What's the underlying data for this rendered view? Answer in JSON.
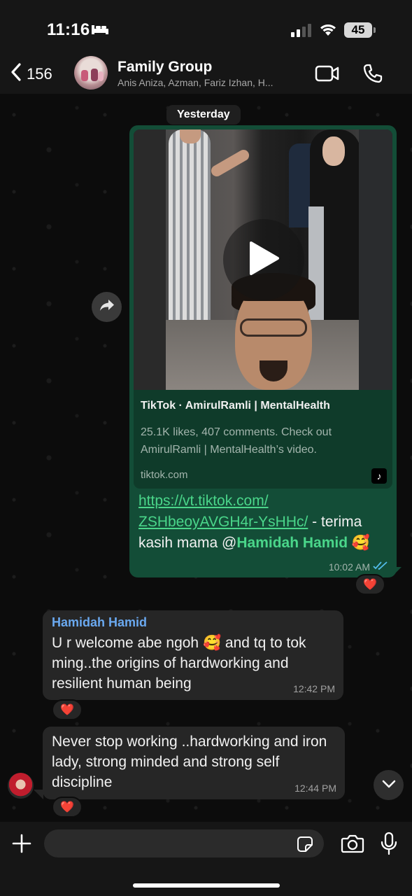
{
  "status_bar": {
    "time": "11:16",
    "battery": "45"
  },
  "header": {
    "back_count": "156",
    "group_name": "Family Group",
    "members": "Anis Aniza, Azman, Fariz Izhan, H..."
  },
  "chat": {
    "date_label": "Yesterday",
    "outgoing": {
      "card_title": "TikTok · AmirulRamli | MentalHealth",
      "card_description": "25.1K likes, 407 comments. Check out AmirulRamli | MentalHealth’s video.",
      "card_domain": "tiktok.com",
      "link_line1": "https://vt.tiktok.com/",
      "link_line2": "ZSHbeoyAVGH4r-YsHHc/",
      "text_after_link": " - terima kasih mama @",
      "mention": "Hamidah Hamid",
      "emoji": "🥰",
      "time": "10:02 AM",
      "reaction": "❤️"
    },
    "incoming": [
      {
        "sender": "Hamidah Hamid",
        "text": "U r welcome abe ngoh 🥰 and tq to tok ming..the origins of hardworking and resilient human being",
        "time": "12:42 PM",
        "reaction": "❤️"
      },
      {
        "text": "Never stop working ..hardworking and iron lady, strong minded and strong self discipline",
        "time": "12:44 PM",
        "reaction": "❤️"
      }
    ]
  },
  "input": {
    "placeholder": ""
  },
  "colors": {
    "outgoing_bubble": "#134d37",
    "incoming_bubble": "#262626",
    "link_green": "#4ad68a",
    "sender_blue": "#6aa9f0",
    "read_ticks": "#53bdeb"
  }
}
